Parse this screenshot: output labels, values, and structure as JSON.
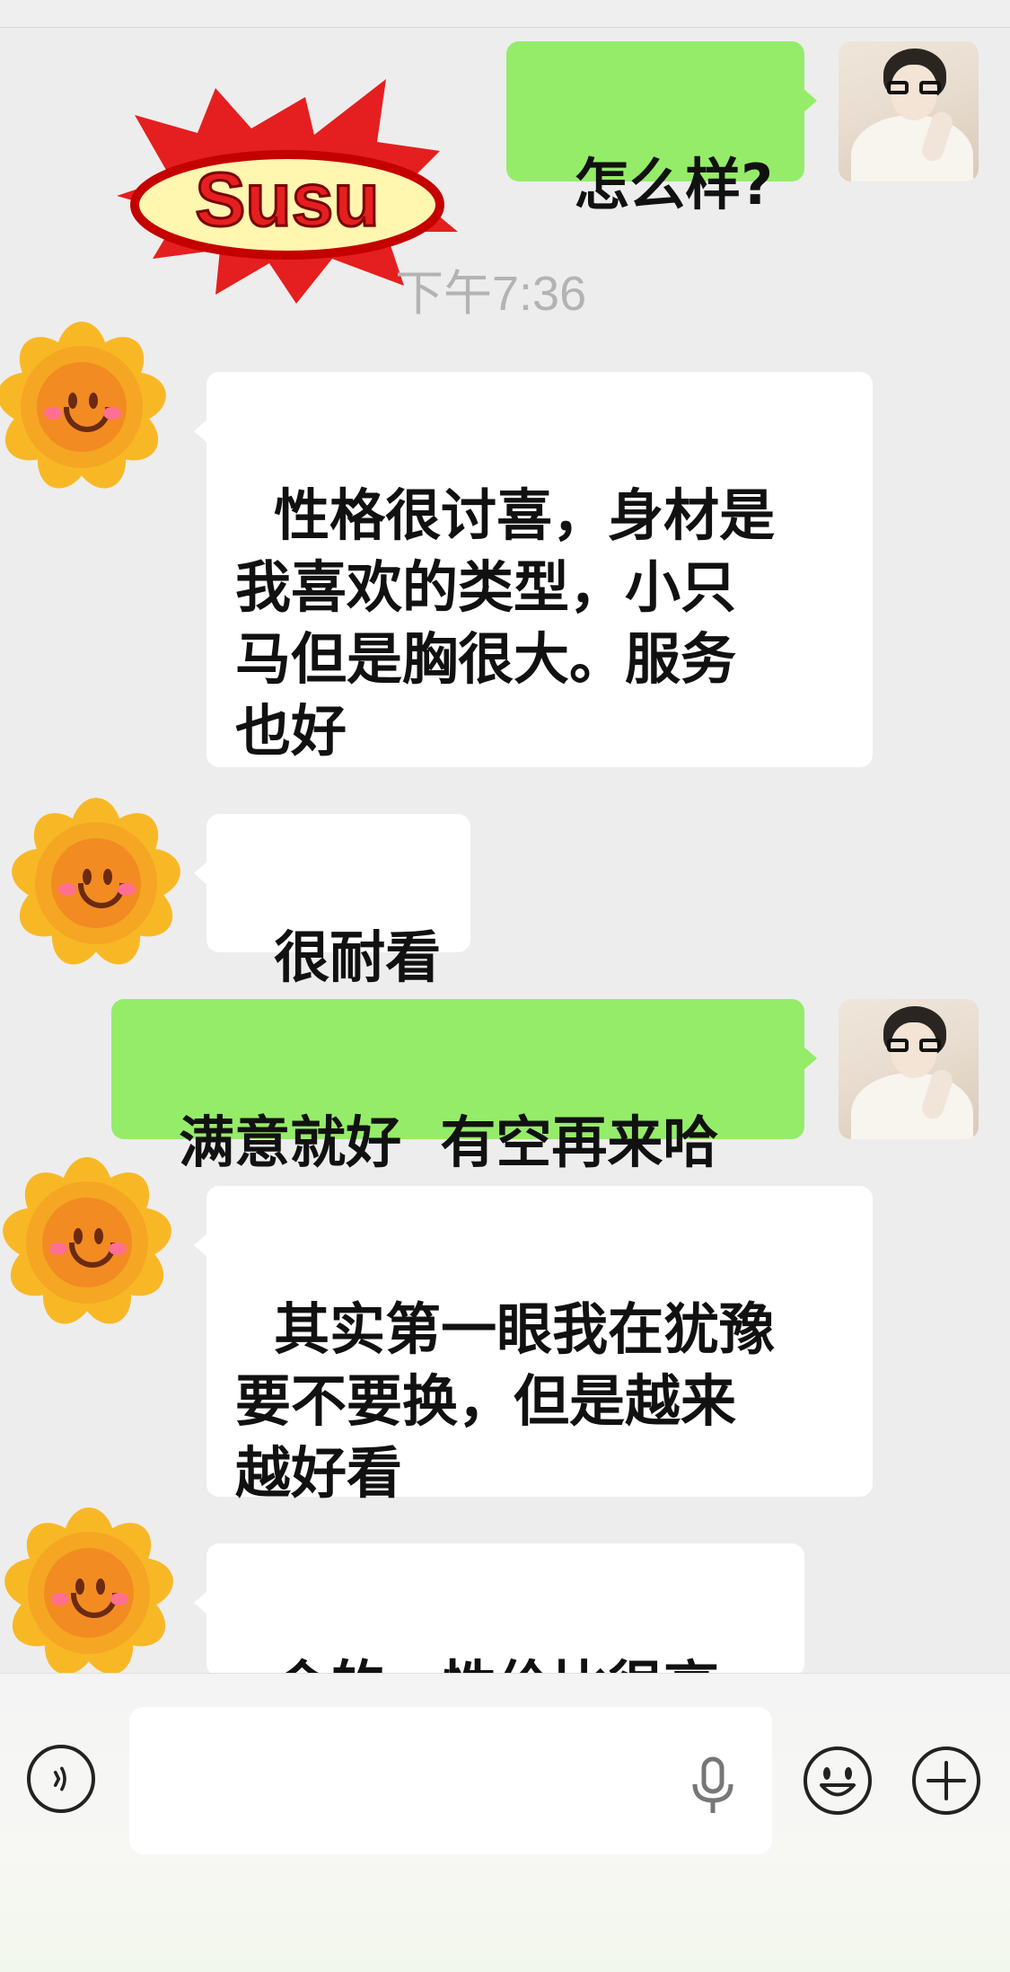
{
  "chat": {
    "timestamp": "下午7:36",
    "messages": [
      {
        "side": "out",
        "text": "怎么样?"
      },
      {
        "side": "in",
        "text": "性格很讨喜，身材是\n我喜欢的类型，小只\n马但是胸很大。服务\n也好"
      },
      {
        "side": "in",
        "text": "很耐看"
      },
      {
        "side": "out",
        "text": "满意就好  有空再来哈"
      },
      {
        "side": "in",
        "text": "其实第一眼我在犹豫\n要不要换，但是越来\n越好看"
      },
      {
        "side": "in",
        "text": "会的，性价比很高"
      }
    ]
  },
  "sticker": {
    "text": "Susu"
  },
  "icons": {
    "voice": "voice-icon",
    "mic": "microphone-icon",
    "emoji": "emoji-icon",
    "plus": "plus-icon",
    "incoming_avatar": "sunflower-avatar-icon"
  },
  "colors": {
    "outgoing_bubble": "#95ec69",
    "incoming_bubble": "#ffffff",
    "background": "#ededed",
    "timestamp": "#b3b3b3"
  }
}
